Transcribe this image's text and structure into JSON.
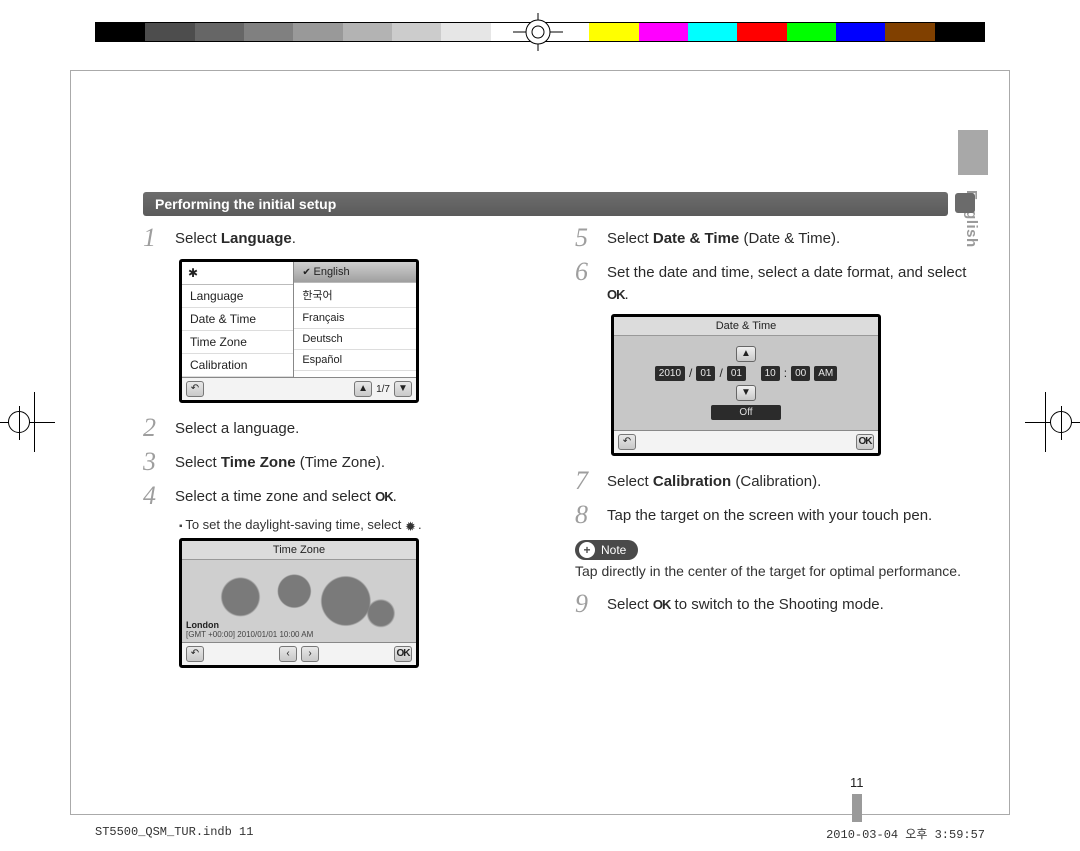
{
  "page": {
    "header": "Performing the initial setup",
    "side_tab": "English",
    "number": "11",
    "footer_left": "ST5500_QSM_TUR.indb   11",
    "footer_right": "2010-03-04   오후 3:59:57"
  },
  "steps": {
    "s1": {
      "n": "1",
      "pre": "Select ",
      "bold": "Language",
      "post": "."
    },
    "s2": {
      "n": "2",
      "text": "Select a language."
    },
    "s3": {
      "n": "3",
      "pre": "Select ",
      "bold": "Time Zone",
      "post": " (Time Zone)."
    },
    "s4": {
      "n": "4",
      "pre": "Select a time zone and select ",
      "post": "."
    },
    "s4sub": "To set the daylight-saving time, select ",
    "s5": {
      "n": "5",
      "pre": "Select ",
      "bold": "Date & Time",
      "post": " (Date & Time)."
    },
    "s6": {
      "n": "6",
      "pre": "Set the date and time, select a date format, and select ",
      "post": "."
    },
    "s7": {
      "n": "7",
      "pre": "Select ",
      "bold": "Calibration",
      "post": " (Calibration)."
    },
    "s8": {
      "n": "8",
      "text": "Tap the target on the screen with your touch pen."
    },
    "s9": {
      "n": "9",
      "pre": "Select ",
      "post": " to switch to the Shooting mode."
    }
  },
  "note": {
    "label": "Note",
    "text": "Tap directly in the center of the target for optimal performance."
  },
  "shot1": {
    "left": [
      "Language",
      "Date & Time",
      "Time Zone",
      "Calibration"
    ],
    "right_selected": "English",
    "right": [
      "한국어",
      "Français",
      "Deutsch",
      "Español"
    ],
    "pager": "1/7"
  },
  "shot2": {
    "title": "Time Zone",
    "city": "London",
    "gmt": "[GMT +00:00] 2010/01/01 10:00 AM"
  },
  "shot3": {
    "title": "Date & Time",
    "year": "2010",
    "m": "01",
    "d": "01",
    "hh": "10",
    "mm": "00",
    "ap": "AM",
    "off": "Off"
  },
  "strip_colors": [
    "#000000",
    "#4d4d4d",
    "#666666",
    "#808080",
    "#999999",
    "#b3b3b3",
    "#cccccc",
    "#e6e6e6",
    "#ffffff",
    "#ffffff",
    "#ffff00",
    "#ff00ff",
    "#00ffff",
    "#ff0000",
    "#00ff00",
    "#0000ff",
    "#804000",
    "#000000"
  ],
  "icons": {
    "ok": "OK",
    "back": "↶",
    "up": "▲",
    "down": "▼",
    "left": "‹",
    "right": "›",
    "gear": "✱",
    "sun": "✹"
  }
}
